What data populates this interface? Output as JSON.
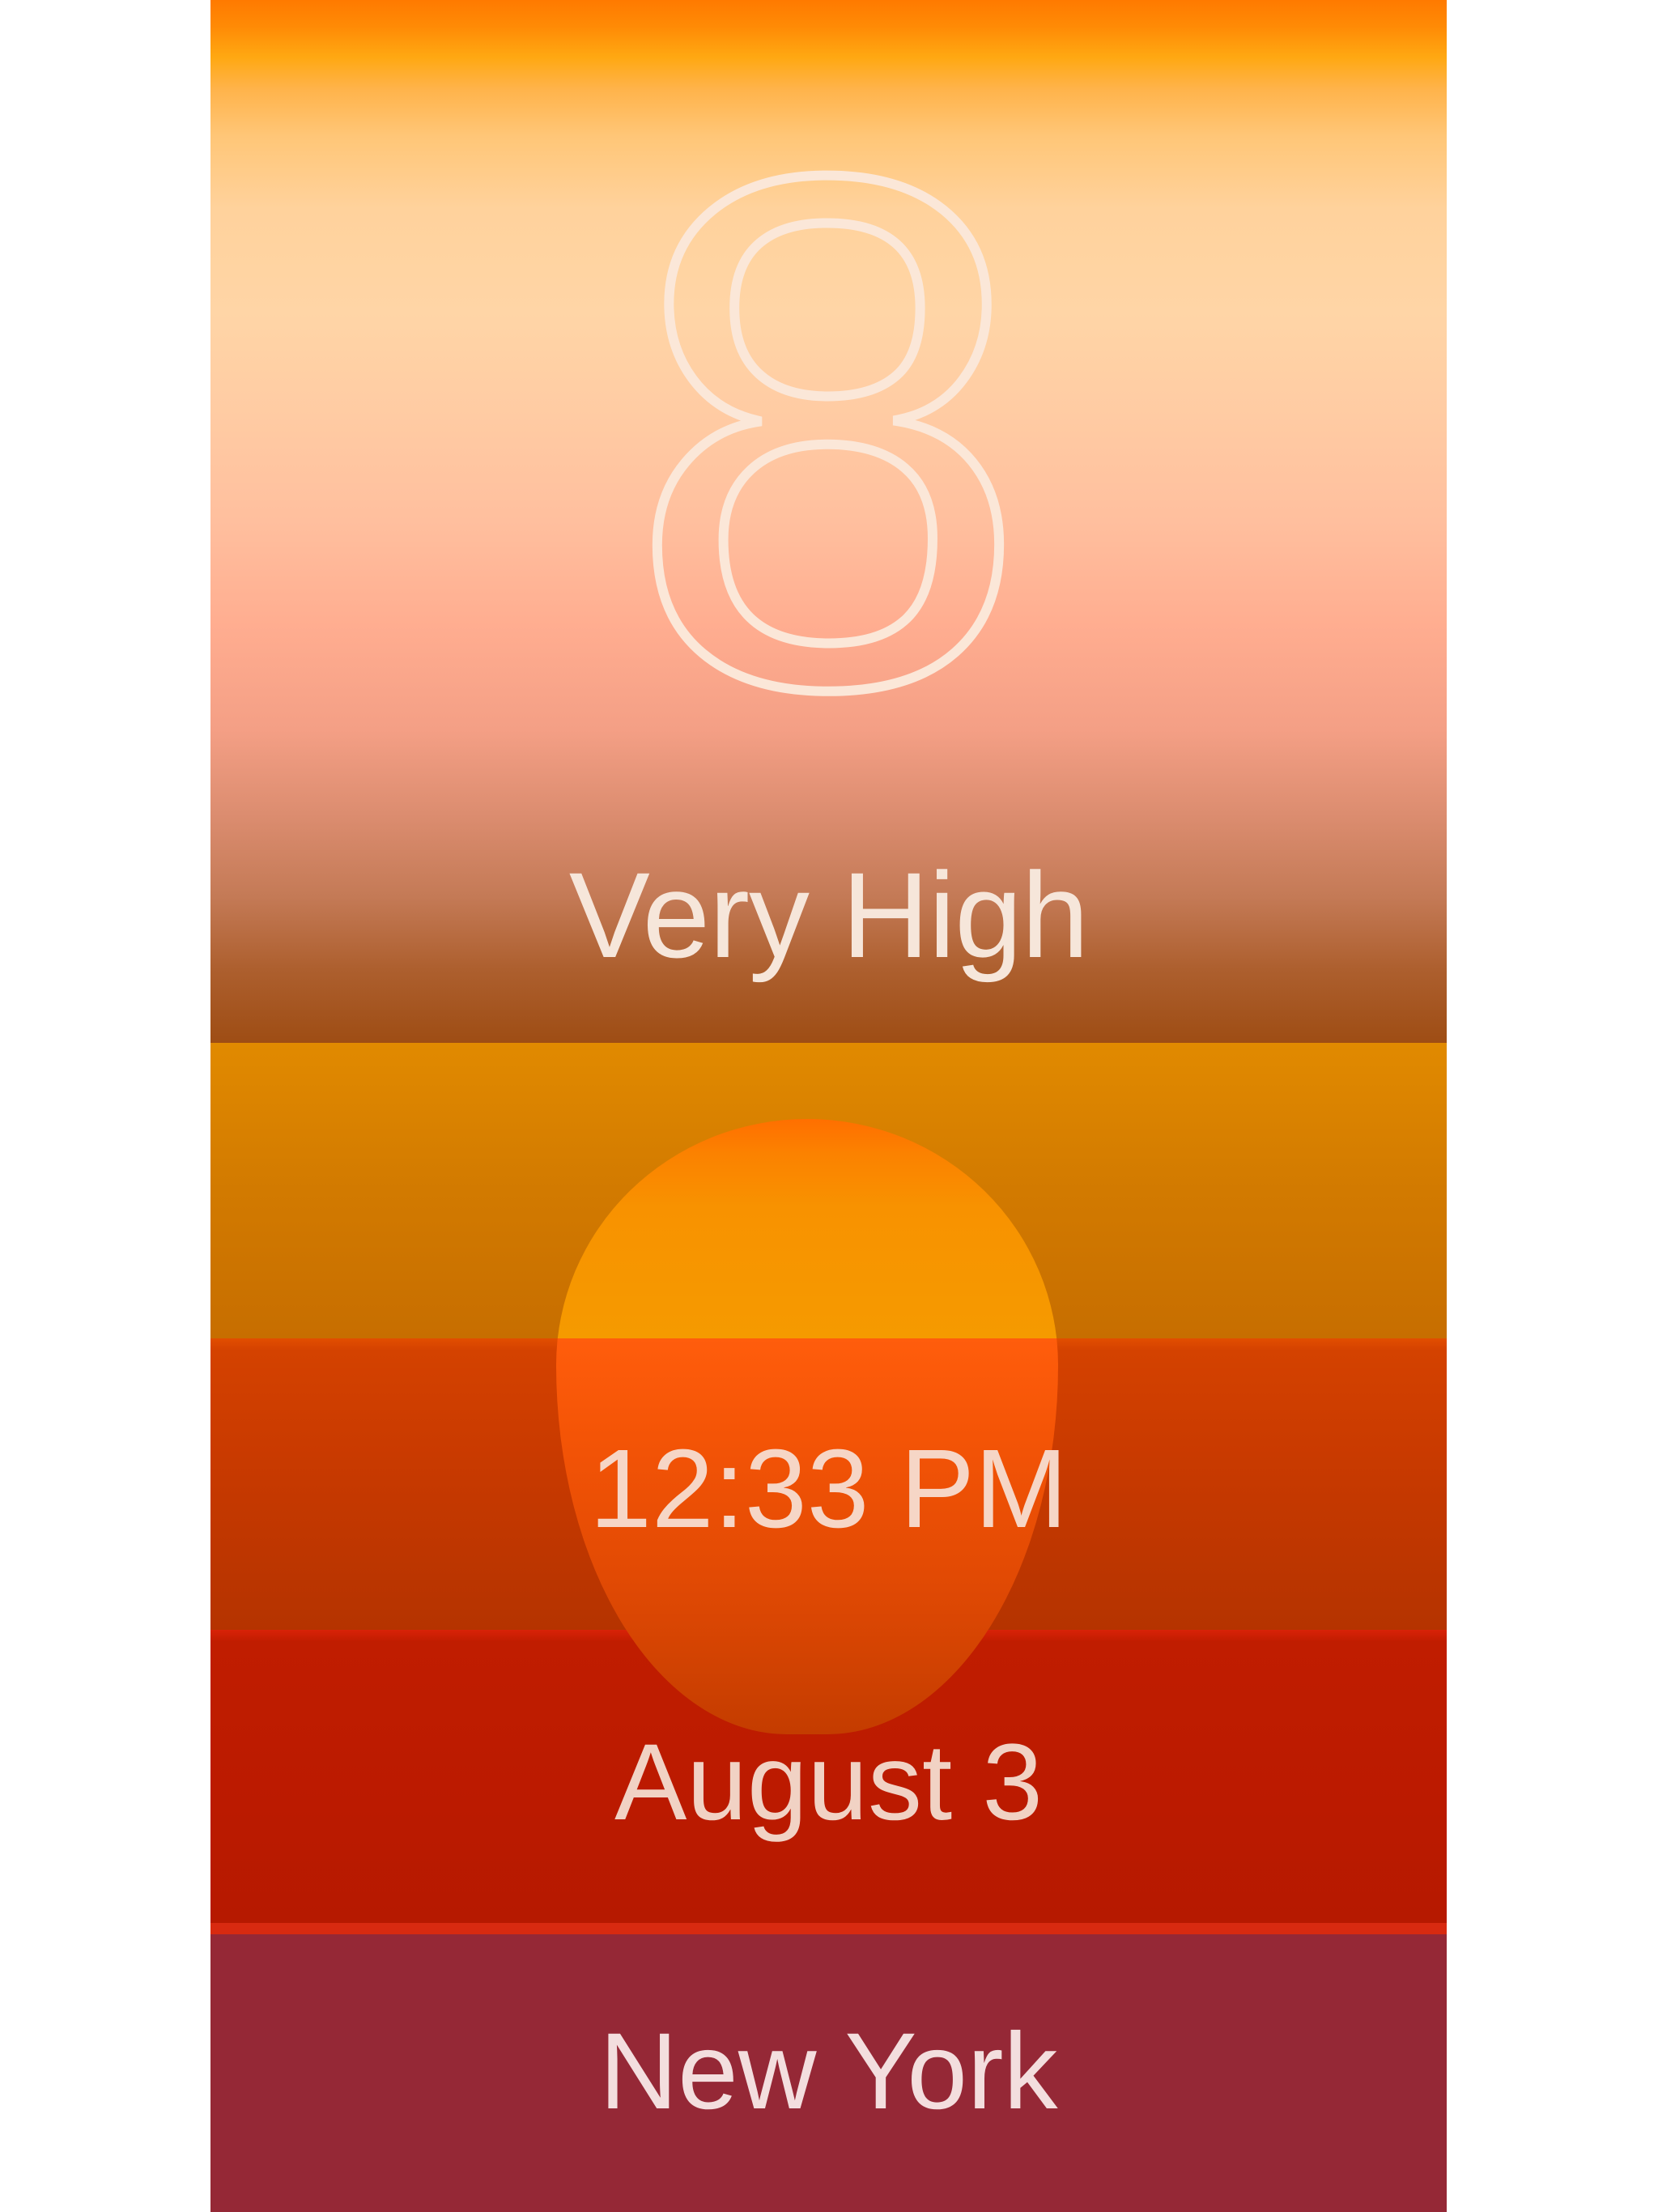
{
  "uv": {
    "index": "8",
    "level": "Very High"
  },
  "details": {
    "time": "12:33 PM",
    "date": "August 3",
    "city": "New York"
  },
  "colors": {
    "sky_top": "#ff7a00",
    "sky_mid": "#ffd5a6",
    "horizon": "#9e4d14",
    "sun": "#f59a00",
    "band_time": "#c93a00",
    "band_date": "#bb1a00",
    "band_city": "#952836",
    "text": "#f6e6da"
  }
}
